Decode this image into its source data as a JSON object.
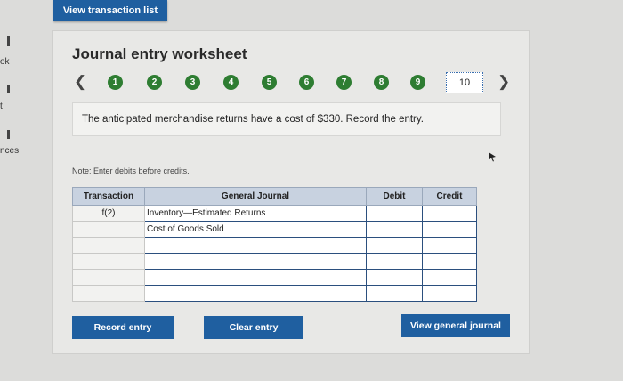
{
  "left_strip": {
    "frag1": "ok",
    "frag2": "t",
    "frag3": "nces"
  },
  "header": {
    "view_transaction_list": "View transaction list"
  },
  "worksheet": {
    "title": "Journal entry worksheet",
    "steps": [
      "1",
      "2",
      "3",
      "4",
      "5",
      "6",
      "7",
      "8",
      "9"
    ],
    "current_step": "10",
    "prompt": "The anticipated merchandise returns have a cost of $330. Record the entry.",
    "note": "Note: Enter debits before credits."
  },
  "table": {
    "headers": {
      "transaction": "Transaction",
      "general_journal": "General Journal",
      "debit": "Debit",
      "credit": "Credit"
    },
    "rows": [
      {
        "transaction": "f(2)",
        "account": "Inventory—Estimated Returns",
        "debit": "",
        "credit": ""
      },
      {
        "transaction": "",
        "account": "Cost of Goods Sold",
        "debit": "",
        "credit": ""
      },
      {
        "transaction": "",
        "account": "",
        "debit": "",
        "credit": ""
      },
      {
        "transaction": "",
        "account": "",
        "debit": "",
        "credit": ""
      },
      {
        "transaction": "",
        "account": "",
        "debit": "",
        "credit": ""
      },
      {
        "transaction": "",
        "account": "",
        "debit": "",
        "credit": ""
      }
    ]
  },
  "buttons": {
    "record_entry": "Record entry",
    "clear_entry": "Clear entry",
    "view_general_journal": "View general journal"
  },
  "colors": {
    "primary": "#1f5fa0",
    "step_done": "#2e7d32"
  }
}
